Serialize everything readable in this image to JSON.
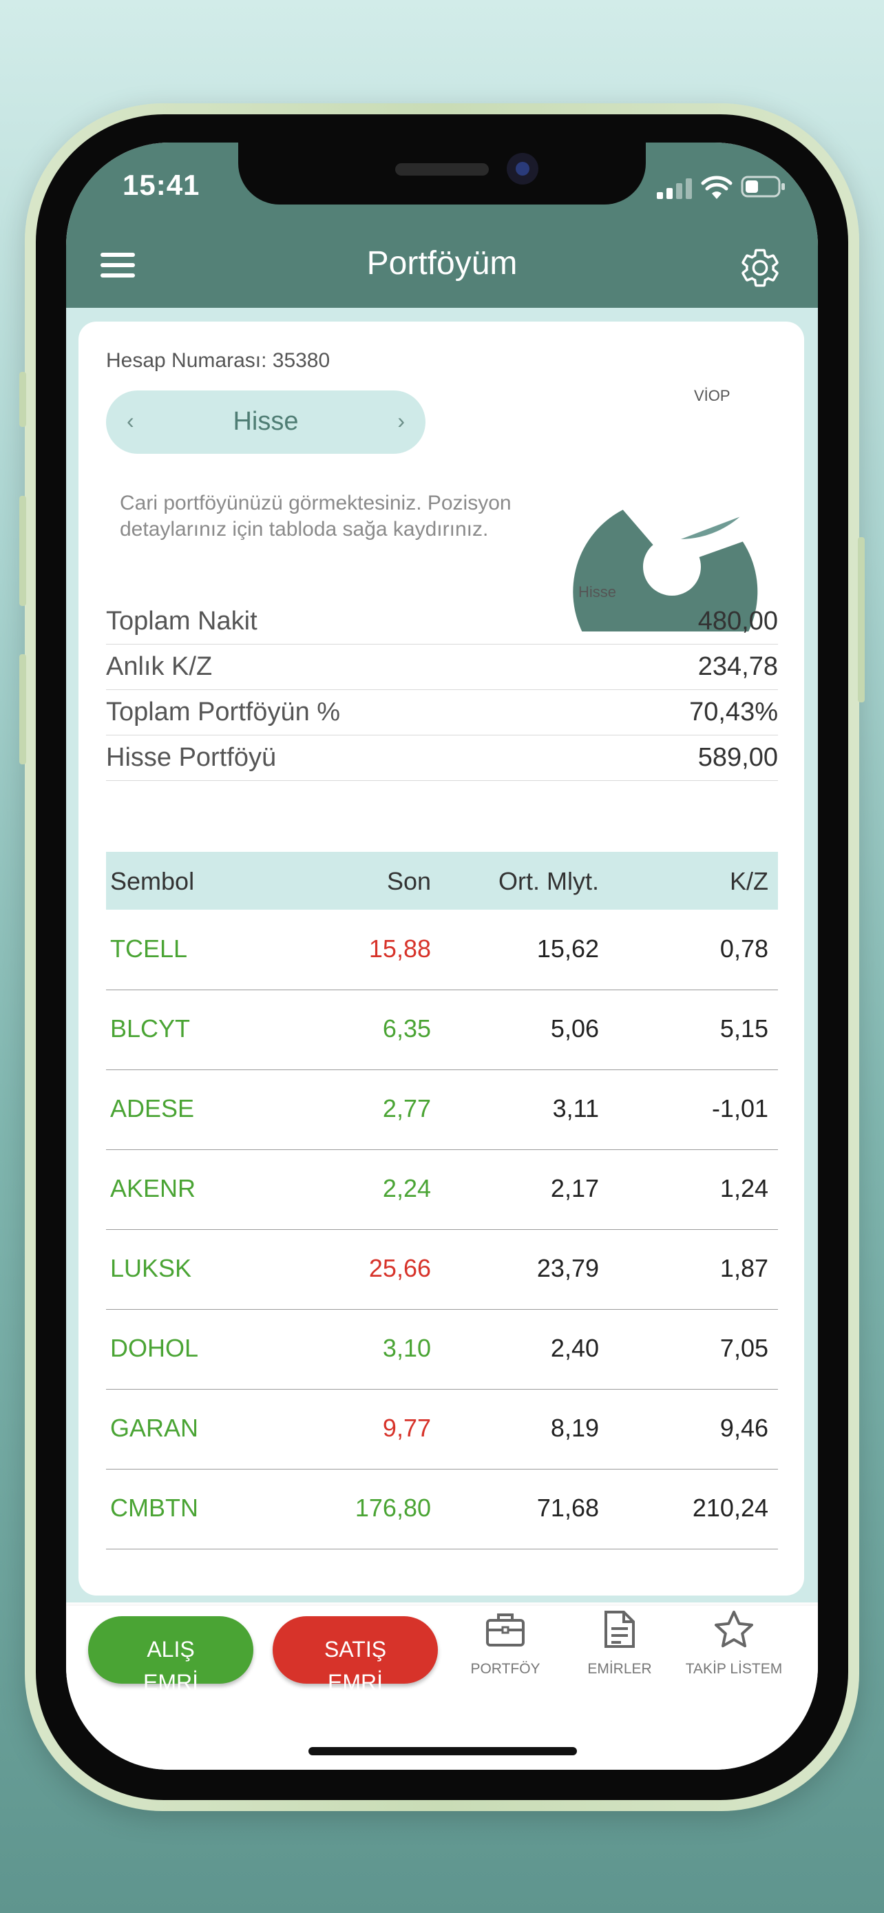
{
  "status_bar": {
    "time": "15:41"
  },
  "nav": {
    "title": "Portföyüm"
  },
  "account": {
    "label": "Hesap Numarası: 35380"
  },
  "segment": {
    "label": "Hisse",
    "prev": "‹",
    "next": "›"
  },
  "info_text": "Cari portföyünüzü görmektesiniz. Pozisyon detaylarınız için tabloda sağa kaydırınız.",
  "pie": {
    "labels": [
      "VİOP",
      "Hisse"
    ],
    "colors": [
      "#6f9b94",
      "#568177"
    ]
  },
  "summary": [
    {
      "key": "Toplam Nakit",
      "value": "480,00"
    },
    {
      "key": "Anlık K/Z",
      "value": "234,78"
    },
    {
      "key": "Toplam Portföyün %",
      "value": "70,43%"
    },
    {
      "key": "Hisse Portföyü",
      "value": "589,00"
    }
  ],
  "table": {
    "headers": [
      "Sembol",
      "Son",
      "Ort. Mlyt.",
      "K/Z"
    ],
    "rows": [
      {
        "symbol": "TCELL",
        "last": "15,88",
        "last_color": "red",
        "avg": "15,62",
        "pl": "0,78"
      },
      {
        "symbol": "BLCYT",
        "last": "6,35",
        "last_color": "green",
        "avg": "5,06",
        "pl": "5,15"
      },
      {
        "symbol": "ADESE",
        "last": "2,77",
        "last_color": "green",
        "avg": "3,11",
        "pl": "-1,01"
      },
      {
        "symbol": "AKENR",
        "last": "2,24",
        "last_color": "green",
        "avg": "2,17",
        "pl": "1,24"
      },
      {
        "symbol": "LUKSK",
        "last": "25,66",
        "last_color": "red",
        "avg": "23,79",
        "pl": "1,87"
      },
      {
        "symbol": "DOHOL",
        "last": "3,10",
        "last_color": "green",
        "avg": "2,40",
        "pl": "7,05"
      },
      {
        "symbol": "GARAN",
        "last": "9,77",
        "last_color": "red",
        "avg": "8,19",
        "pl": "9,46"
      },
      {
        "symbol": "CMBTN",
        "last": "176,80",
        "last_color": "green",
        "avg": "71,68",
        "pl": "210,24"
      }
    ]
  },
  "bottom": {
    "buy_line1": "ALIŞ",
    "buy_line2": "EMRİ",
    "sell_line1": "SATIŞ",
    "sell_line2": "EMRİ",
    "tabs": [
      {
        "label": "PORTFÖY",
        "icon": "briefcase-icon"
      },
      {
        "label": "EMİRLER",
        "icon": "document-icon"
      },
      {
        "label": "TAKİP LİSTEM",
        "icon": "star-icon"
      }
    ]
  },
  "colors": {
    "header": "#548177",
    "accent_light": "#cfeae8",
    "buy": "#4aa434",
    "sell": "#d7332a",
    "up": "#4aa434",
    "down": "#d7332a"
  }
}
